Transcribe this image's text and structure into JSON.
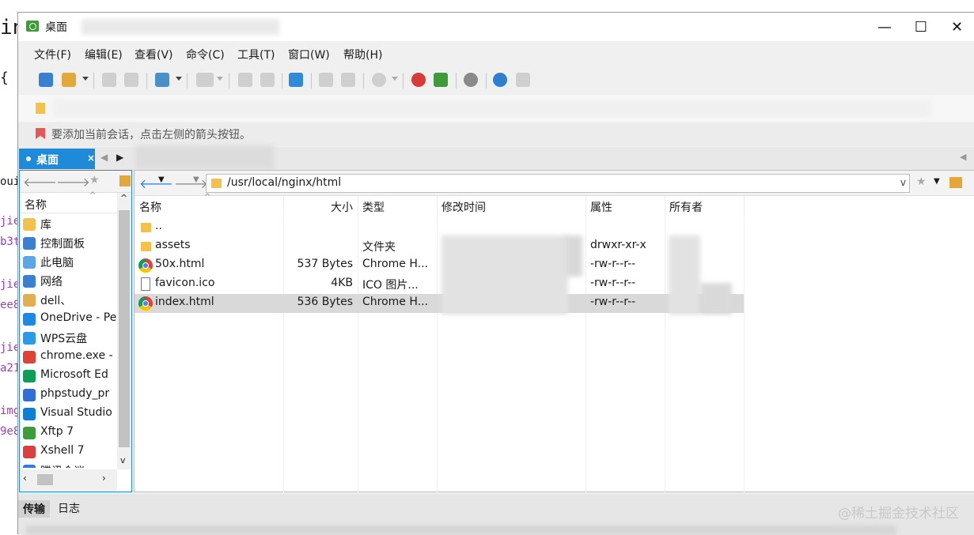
{
  "background_editor": {
    "lines": [
      "in",
      "{",
      "oui",
      "jie",
      "b3t",
      "jie",
      "ee8",
      "jie",
      "a21",
      "img",
      "9e8"
    ]
  },
  "window": {
    "title": "桌面",
    "controls": {
      "minimize": "—",
      "maximize": "☐",
      "close": "✕"
    }
  },
  "menu": [
    "文件(F)",
    "编辑(E)",
    "查看(V)",
    "命令(C)",
    "工具(T)",
    "窗口(W)",
    "帮助(H)"
  ],
  "toolbar_icons": [
    "new-session-icon",
    "open-folder-icon",
    "connect-icon",
    "disconnect-icon",
    "properties-icon",
    "terminal-icon",
    "copy-icon",
    "paste-icon",
    "transfer-icon",
    "sync-icon",
    "sync2-icon",
    "globe-icon",
    "xshell-icon",
    "xftp-icon",
    "settings-icon",
    "help-icon",
    "chat-icon"
  ],
  "hint": {
    "text": "要添加当前会话，点击左侧的箭头按钮。"
  },
  "tabs": {
    "active_label": "桌面",
    "close": "×"
  },
  "left_pane": {
    "header": "名称",
    "items": [
      {
        "label": "库",
        "icon": "library-icon",
        "color": "#f2c14e"
      },
      {
        "label": "控制面板",
        "icon": "control-panel-icon",
        "color": "#3b7fd1"
      },
      {
        "label": "此电脑",
        "icon": "computer-icon",
        "color": "#5aa6e6"
      },
      {
        "label": "网络",
        "icon": "network-icon",
        "color": "#3b7fd1"
      },
      {
        "label": "dell、",
        "icon": "user-folder-icon",
        "color": "#e0b050"
      },
      {
        "label": "OneDrive - Pe",
        "icon": "onedrive-icon",
        "color": "#1e88e5"
      },
      {
        "label": "WPS云盘",
        "icon": "wps-cloud-icon",
        "color": "#2b9be8"
      },
      {
        "label": "chrome.exe -",
        "icon": "chrome-icon",
        "color": "#db4437"
      },
      {
        "label": "Microsoft Ed",
        "icon": "edge-icon",
        "color": "#0f9d58"
      },
      {
        "label": "phpstudy_pr",
        "icon": "phpstudy-icon",
        "color": "#2f6fd6"
      },
      {
        "label": "Visual Studio",
        "icon": "vscode-icon",
        "color": "#0f7fd6"
      },
      {
        "label": "Xftp 7",
        "icon": "xftp-icon",
        "color": "#3f9b3a"
      },
      {
        "label": "Xshell 7",
        "icon": "xshell-icon",
        "color": "#d94040"
      },
      {
        "label": "腾讯会议",
        "icon": "tencent-meeting-icon",
        "color": "#2e7be6"
      }
    ]
  },
  "right_pane": {
    "path": "/usr/local/nginx/html",
    "columns": [
      "名称",
      "大小",
      "类型",
      "修改时间",
      "属性",
      "所有者"
    ],
    "rows": [
      {
        "name": "..",
        "size": "",
        "type": "",
        "perm": "",
        "kind": "folder"
      },
      {
        "name": "assets",
        "size": "",
        "type": "文件夹",
        "perm": "drwxr-xr-x",
        "kind": "folder"
      },
      {
        "name": "50x.html",
        "size": "537 Bytes",
        "type": "Chrome H...",
        "perm": "-rw-r--r--",
        "kind": "chrome"
      },
      {
        "name": "favicon.ico",
        "size": "4KB",
        "type": "ICO 图片...",
        "perm": "-rw-r--r--",
        "kind": "file"
      },
      {
        "name": "index.html",
        "size": "536 Bytes",
        "type": "Chrome H...",
        "perm": "-rw-r--r--",
        "kind": "chrome",
        "selected": true
      }
    ]
  },
  "bottom": {
    "tabs": [
      "传输",
      "日志"
    ],
    "watermark": "@稀土掘金技术社区"
  },
  "colors": {
    "accent": "#1e8ad8",
    "selected_row": "#d9d9d9"
  }
}
